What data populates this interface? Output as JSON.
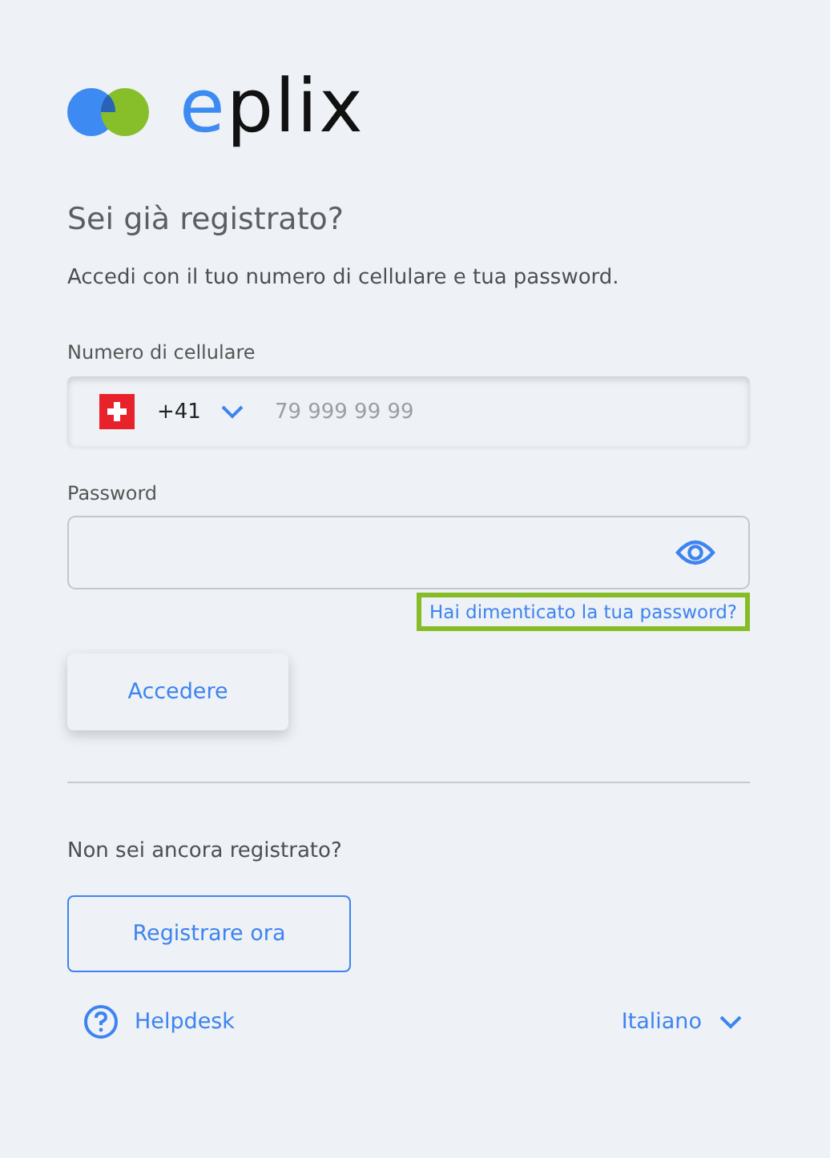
{
  "logo": {
    "text": "eplix"
  },
  "heading": "Sei già registrato?",
  "intro": "Accedi con il tuo numero di cellulare e tua password.",
  "phone": {
    "label": "Numero di cellulare",
    "country_code": "+41",
    "placeholder": "79 999 99 99"
  },
  "password": {
    "label": "Password"
  },
  "forgot_link": {
    "text": "Hai dimenticato la tua password?",
    "focused": true
  },
  "login_button": "Accedere",
  "register_prompt": "Non sei ancora registrato?",
  "register_button": "Registrare ora",
  "footer": {
    "help": "Helpdesk",
    "language": "Italiano"
  }
}
